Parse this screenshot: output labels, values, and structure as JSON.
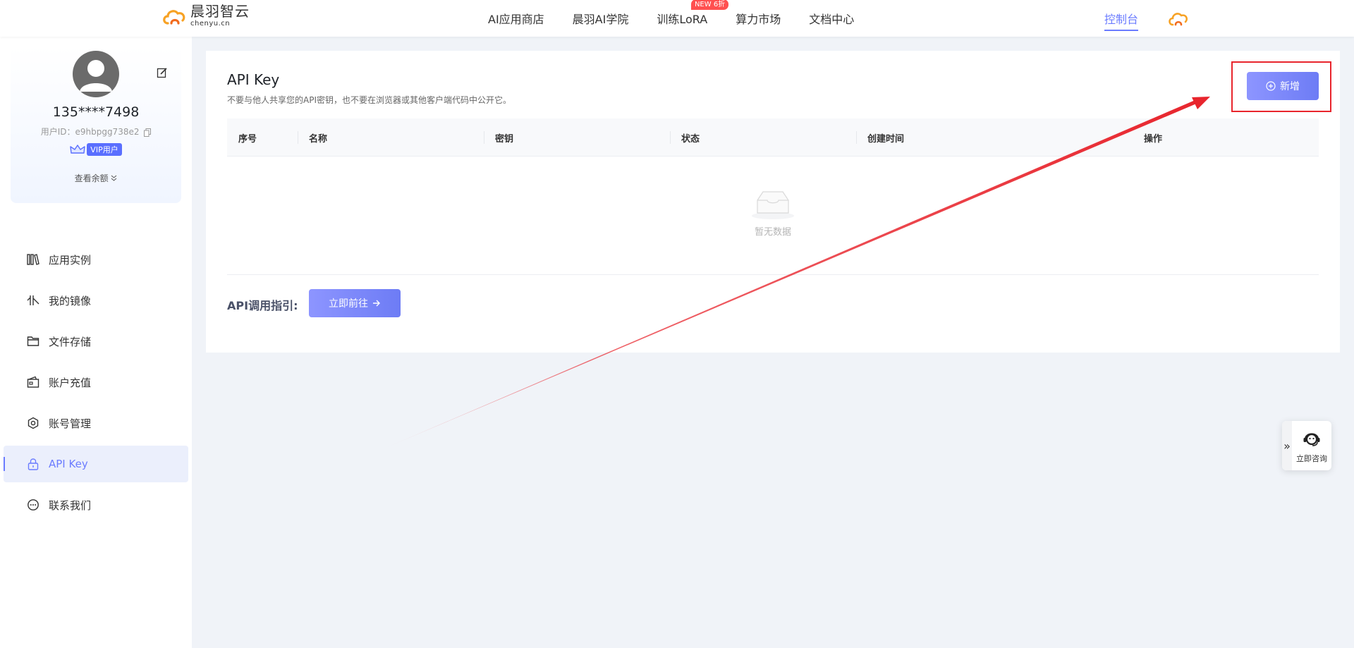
{
  "header": {
    "logo": {
      "name_cn": "晨羽智云",
      "name_en": "chenyu.cn"
    },
    "nav": [
      {
        "label": "AI应用商店"
      },
      {
        "label": "晨羽AI学院"
      },
      {
        "label": "训练LoRA",
        "badge": "NEW 6折"
      },
      {
        "label": "算力市场"
      },
      {
        "label": "文档中心"
      }
    ],
    "console_label": "控制台",
    "accent_color": "#6b7cff"
  },
  "sidebar": {
    "profile": {
      "phone": "135****7498",
      "user_id": "用户ID：e9hbpgg738e2",
      "vip_label": "VIP用户",
      "balance_link": "查看余额"
    },
    "menu": [
      {
        "label": "应用实例",
        "icon": "app-instance-icon"
      },
      {
        "label": "我的镜像",
        "icon": "image-icon"
      },
      {
        "label": "文件存储",
        "icon": "folder-icon"
      },
      {
        "label": "账户充值",
        "icon": "wallet-icon"
      },
      {
        "label": "账号管理",
        "icon": "settings-icon"
      },
      {
        "label": "API Key",
        "icon": "lock-icon",
        "active": true
      },
      {
        "label": "联系我们",
        "icon": "chat-icon"
      }
    ]
  },
  "main": {
    "title": "API Key",
    "description": "不要与他人共享您的API密钥，也不要在浏览器或其他客户端代码中公开它。",
    "add_button": "新增",
    "table": {
      "columns": [
        "序号",
        "名称",
        "密钥",
        "状态",
        "创建时间",
        "操作"
      ],
      "rows": [],
      "empty_text": "暂无数据"
    },
    "guide_label": "API调用指引:",
    "go_button": "立即前往"
  },
  "floating": {
    "collapse": "»",
    "consult_label": "立即咨询"
  },
  "annotation": {
    "color": "#e8252d"
  }
}
